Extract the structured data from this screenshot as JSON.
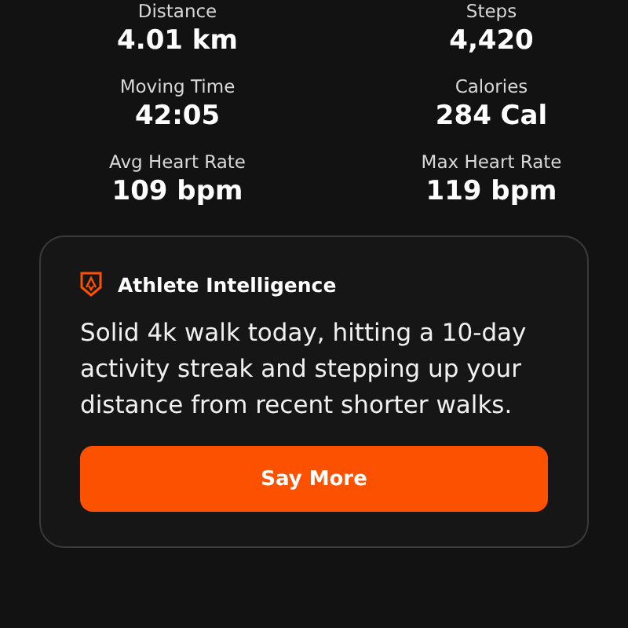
{
  "stats": [
    {
      "label": "Distance",
      "value": "4.01 km"
    },
    {
      "label": "Steps",
      "value": "4,420"
    },
    {
      "label": "Moving Time",
      "value": "42:05"
    },
    {
      "label": "Calories",
      "value": "284 Cal"
    },
    {
      "label": "Avg Heart Rate",
      "value": "109 bpm"
    },
    {
      "label": "Max Heart Rate",
      "value": "119 bpm"
    }
  ],
  "insight": {
    "title": "Athlete Intelligence",
    "text": "Solid 4k walk today, hitting a 10-day activity streak and stepping up your distance from recent shorter walks.",
    "button": "Say More"
  }
}
